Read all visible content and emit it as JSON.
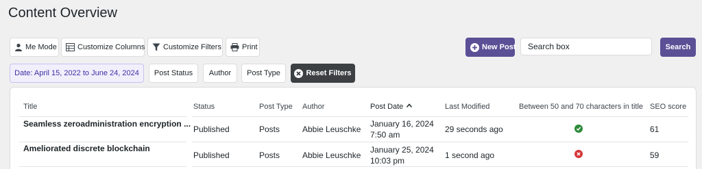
{
  "page": {
    "title": "Content Overview"
  },
  "toolbar": {
    "me_mode": "Me Mode",
    "customize_columns": "Customize Columns",
    "customize_filters": "Customize Filters",
    "print": "Print",
    "new_post": "New Post",
    "search_placeholder": "Search box",
    "search": "Search"
  },
  "filters": {
    "date": "Date: April 15, 2022 to June 24, 2024",
    "post_status": "Post Status",
    "author": "Author",
    "post_type": "Post Type",
    "reset": "Reset Filters"
  },
  "table": {
    "headers": {
      "title": "Title",
      "status": "Status",
      "post_type": "Post Type",
      "author": "Author",
      "post_date": "Post Date",
      "last_modified": "Last Modified",
      "length_check": "Between 50 and 70 characters in title",
      "seo_score": "SEO score"
    },
    "sort": {
      "column": "post_date",
      "direction": "ascending"
    },
    "rows": [
      {
        "title": "Seamless zeroadministration encryption ...",
        "status": "Published",
        "post_type": "Posts",
        "author": "Abbie Leuschke",
        "post_date_line1": "January 16, 2024",
        "post_date_line2": "7:50 am",
        "last_modified": "29 seconds ago",
        "length_check": "pass",
        "seo_score": "61"
      },
      {
        "title": "Ameliorated discrete blockchain",
        "status": "Published",
        "post_type": "Posts",
        "author": "Abbie Leuschke",
        "post_date_line1": "January 25, 2024",
        "post_date_line2": "10:03 pm",
        "last_modified": "1 second ago",
        "length_check": "fail",
        "seo_score": "59"
      }
    ]
  },
  "colors": {
    "accent": "#5b4f96",
    "pass": "#2e8b3a",
    "fail": "#d63638",
    "reset_bg": "#3c4043",
    "date_filter_bg": "#f2effc"
  }
}
